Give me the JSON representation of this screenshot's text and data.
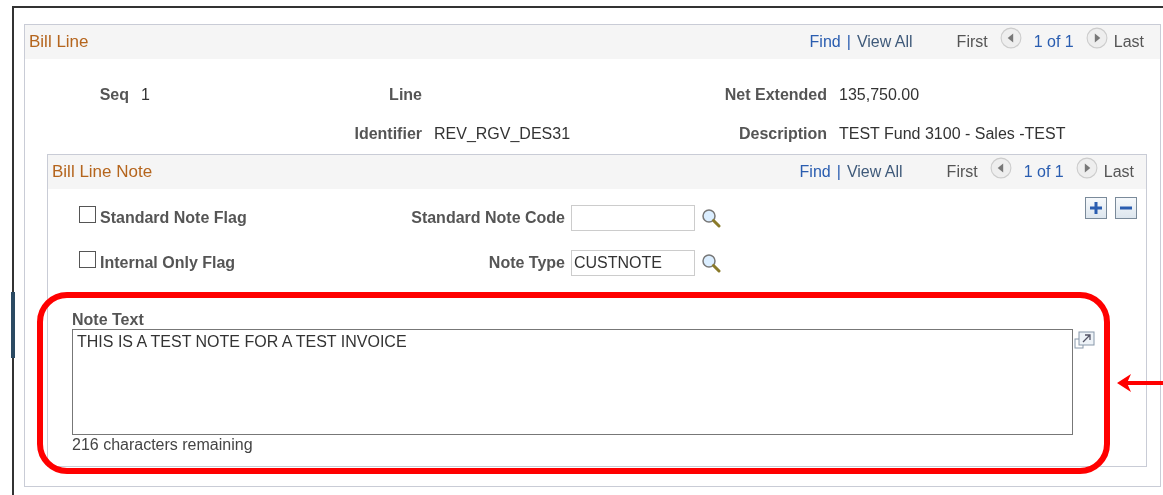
{
  "bill_line": {
    "title": "Bill Line",
    "nav": {
      "find": "Find",
      "separator": "|",
      "view_all": "View All",
      "first": "First",
      "count": "1 of 1",
      "last": "Last"
    },
    "rows": [
      [
        {
          "label": "Seq",
          "value": "1"
        },
        {
          "label": "Line"
        },
        {
          "label": "Net Extended",
          "value": "135,750.00"
        }
      ],
      [
        "",
        {
          "label": "Identifier",
          "value": "REV_RGV_DES31"
        },
        {
          "label": "Description",
          "value": "TEST Fund 3100 - Sales -TEST"
        }
      ]
    ]
  },
  "bill_line_note": {
    "title": "Bill Line Note",
    "nav": {
      "find": "Find",
      "separator": "|",
      "view_all": "View All",
      "first": "First",
      "count": "1 of 1",
      "last": "Last"
    },
    "flags": [
      {
        "label": "Standard Note Flag",
        "checked": false
      },
      {
        "label": "Internal Only Flag",
        "checked": false
      }
    ],
    "fields": [
      {
        "label": "Standard Note Code"
      },
      {
        "label": "Note Type",
        "value": "CUSTNOTE"
      }
    ],
    "note_text": {
      "label": "Note Text",
      "value": "THIS IS A TEST NOTE FOR A TEST INVOICE",
      "remaining": "216 characters remaining"
    }
  }
}
